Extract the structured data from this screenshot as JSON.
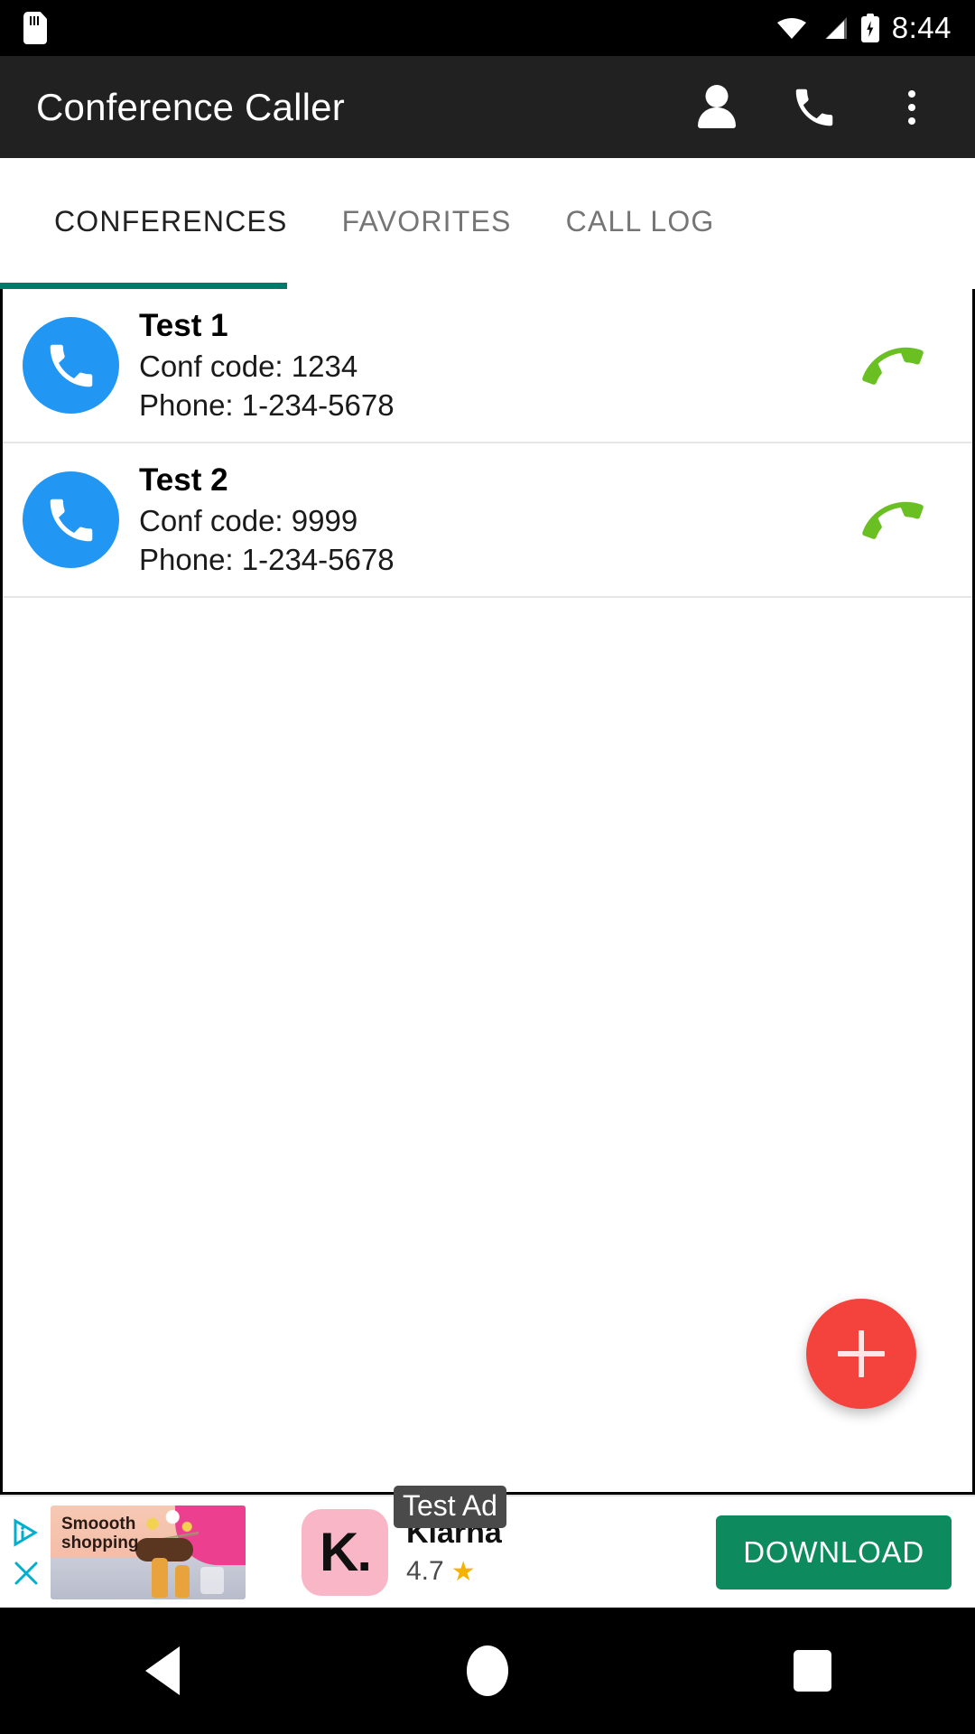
{
  "status_bar": {
    "sd_card_icon": "sd-card-icon",
    "wifi_icon": "wifi-icon",
    "signal_icon": "cellular-signal-icon",
    "battery_icon": "battery-charging-icon",
    "time": "8:44"
  },
  "app_bar": {
    "title": "Conference Caller",
    "actions": [
      {
        "icon": "person-icon",
        "name": "contacts-button"
      },
      {
        "icon": "phone-icon",
        "name": "dialer-button"
      },
      {
        "icon": "overflow-menu-icon",
        "name": "overflow-menu-button"
      }
    ]
  },
  "tabs": {
    "items": [
      {
        "label": "CONFERENCES",
        "active": true
      },
      {
        "label": "FAVORITES",
        "active": false
      },
      {
        "label": "CALL LOG",
        "active": false
      }
    ],
    "indicator_color": "#00796B"
  },
  "conferences": [
    {
      "name": "Test 1",
      "conf_code": "Conf code: 1234",
      "phone": "Phone: 1-234-5678",
      "avatar_icon": "phone-avatar-icon",
      "call_icon": "call-handset-icon"
    },
    {
      "name": "Test 2",
      "conf_code": "Conf code: 9999",
      "phone": "Phone: 1-234-5678",
      "avatar_icon": "phone-avatar-icon",
      "call_icon": "call-handset-icon"
    }
  ],
  "fab": {
    "icon": "plus-icon",
    "label": "Add conference",
    "color": "#F4433C"
  },
  "ad": {
    "adchoices_icon": "adchoices-icon",
    "close_icon": "close-icon",
    "image_headline": "Smoooth\nshopping",
    "logo_text": "K.",
    "badge": "Test Ad",
    "title": "Klarna",
    "rating": "4.7",
    "star": "★",
    "cta_label": "DOWNLOAD",
    "cta_color": "#0E8A5F"
  },
  "nav_bar": {
    "back": "back-button",
    "home": "home-button",
    "recents": "recents-button"
  },
  "colors": {
    "app_bar": "#212121",
    "accent": "#00796B",
    "avatar_blue": "#2196F3",
    "call_green": "#6ABF22",
    "fab_red": "#F4433C"
  }
}
